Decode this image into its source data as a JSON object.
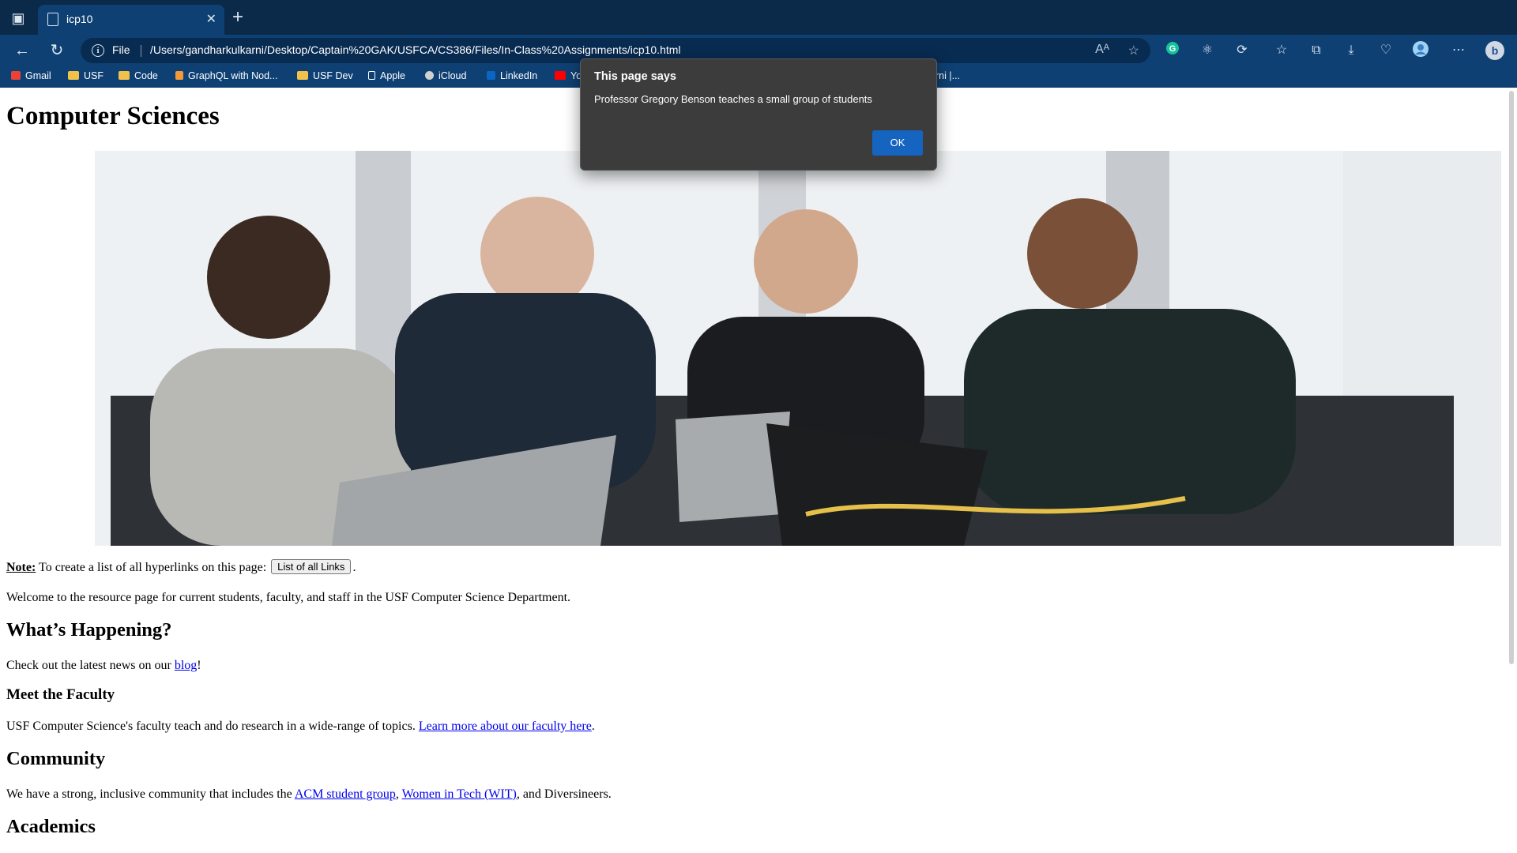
{
  "browser": {
    "tab": {
      "title": "icp10"
    },
    "address": {
      "scheme": "File",
      "url": "/Users/gandharkulkarni/Desktop/Captain%20GAK/USFCA/CS386/Files/In-Class%20Assignments/icp10.html"
    },
    "bookmarks": [
      "Gmail",
      "USF",
      "Code",
      "GraphQL with Nod...",
      "USF Dev",
      "Apple",
      "iCloud",
      "LinkedIn",
      "Yo",
      "lkarni |..."
    ]
  },
  "page": {
    "title": "Computer Sciences",
    "note_label": "Note:",
    "note_text": "To create a list of all hyperlinks on this page:",
    "links_button": "List of all Links",
    "welcome": "Welcome to the resource page for current students, faculty, and staff in the USF Computer Science Department.",
    "whats_happening": "What’s Happening?",
    "news_pre": "Check out the latest news on our",
    "blog_link": "blog",
    "news_post": "!",
    "meet_faculty": "Meet the Faculty",
    "faculty_text": "USF Computer Science's faculty teach and do research in a wide-range of topics.",
    "faculty_link": "Learn more about our faculty here",
    "community": "Community",
    "community_pre": "We have a strong, inclusive community that includes the",
    "acm_link": "ACM student group",
    "wit_link": "Women in Tech (WIT)",
    "community_post": ", and Diversineers.",
    "academics": "Academics"
  },
  "dialog": {
    "title": "This page says",
    "message": "Professor Gregory Benson teaches a small group of students",
    "ok": "OK"
  }
}
